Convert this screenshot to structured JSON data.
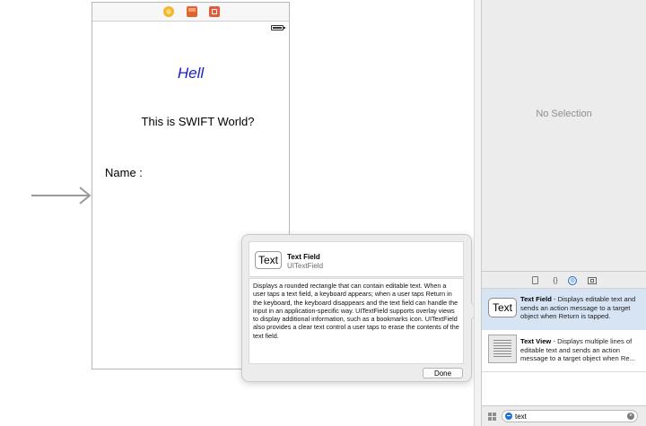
{
  "scene": {
    "hello_label": "Hell",
    "world_label": "This is SWIFT World?",
    "name_label": "Name :"
  },
  "popover": {
    "thumb_text": "Text",
    "title": "Text Field",
    "class_name": "UITextField",
    "description": "Displays a rounded rectangle that can contain editable text. When a user taps a text field, a keyboard appears; when a user taps Return in the keyboard, the keyboard disappears and the text field can handle the input in an application-specific way. UITextField supports overlay views to display additional information, such as a bookmarks icon. UITextField also provides a clear text control a user taps to erase the contents of the text field.",
    "done_label": "Done"
  },
  "inspector": {
    "empty_text": "No Selection"
  },
  "library": {
    "items": [
      {
        "thumb_text": "Text",
        "name": "Text Field",
        "summary": " - Displays editable text and sends an action message to a target object when Return is tapped.",
        "selected": true
      },
      {
        "thumb_text": "",
        "name": "Text View",
        "summary": " - Displays multiple lines of editable text and sends an action message to a target object when Re...",
        "selected": false
      }
    ],
    "filter_value": "text"
  },
  "colors": {
    "hello_text": "#1a1ec9",
    "selection": "#d6e4f4",
    "accent": "#1a73d9"
  }
}
